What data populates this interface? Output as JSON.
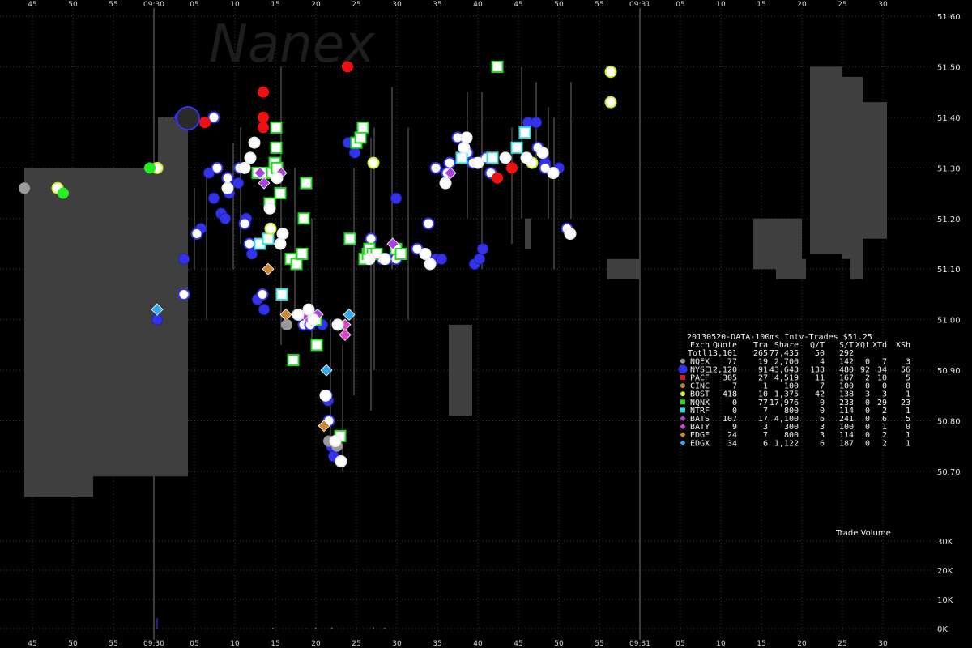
{
  "chart_data": {
    "type": "scatter",
    "watermark": "Nanex",
    "x_axis": {
      "unit": "seconds",
      "ticks": [
        "45",
        "50",
        "55",
        "09:30",
        "05",
        "10",
        "15",
        "20",
        "25",
        "30",
        "35",
        "40",
        "45",
        "50",
        "55",
        "09:31",
        "05",
        "10",
        "15",
        "20",
        "25",
        "30"
      ],
      "xlim": [
        -16,
        96
      ]
    },
    "y_axis_price": {
      "ylim": [
        50.6,
        51.6
      ],
      "ticks": [
        "51.60",
        "51.50",
        "51.40",
        "51.30",
        "51.20",
        "51.10",
        "51.00",
        "50.90",
        "50.80",
        "50.70"
      ]
    },
    "y_axis_volume": {
      "title": "Trade Volume",
      "ticks": [
        "30K",
        "20K",
        "10K",
        "0K"
      ],
      "ylim": [
        0,
        30000
      ]
    },
    "legend_table": {
      "title": "20130520-DATA-100ms Intv-Trades $51.25",
      "columns": [
        "Exch",
        "Quote",
        "Tra",
        "Share",
        "Q/T",
        "S/T",
        "XQt",
        "XTd",
        "XSh"
      ],
      "total_row": [
        "Totl",
        "13,101",
        "265",
        "77,435",
        "50",
        "292",
        "",
        "",
        ""
      ],
      "rows": [
        {
          "exch": "NQEX",
          "quote": "77",
          "tra": "19",
          "share": "2,700",
          "qt": "4",
          "st": "142",
          "xqt": "0",
          "xtd": "7",
          "xsh": "3",
          "color": "#9a9a9a",
          "marker": "circle"
        },
        {
          "exch": "NYSE",
          "quote": "12,120",
          "tra": "91",
          "share": "43,643",
          "qt": "133",
          "st": "480",
          "xqt": "92",
          "xtd": "34",
          "xsh": "56",
          "color": "#3333ee",
          "marker": "circle"
        },
        {
          "exch": "PACF",
          "quote": "305",
          "tra": "27",
          "share": "4,519",
          "qt": "11",
          "st": "167",
          "xqt": "2",
          "xtd": "10",
          "xsh": "5",
          "color": "#ee1111",
          "marker": "square"
        },
        {
          "exch": "CINC",
          "quote": "7",
          "tra": "1",
          "share": "100",
          "qt": "7",
          "st": "100",
          "xqt": "0",
          "xtd": "0",
          "xsh": "0",
          "color": "#b08820",
          "marker": "circle"
        },
        {
          "exch": "BOST",
          "quote": "418",
          "tra": "10",
          "share": "1,375",
          "qt": "42",
          "st": "138",
          "xqt": "3",
          "xtd": "3",
          "xsh": "1",
          "color": "#ccee22",
          "marker": "circle"
        },
        {
          "exch": "NQNX",
          "quote": "0",
          "tra": "77",
          "share": "17,976",
          "qt": "0",
          "st": "233",
          "xqt": "0",
          "xtd": "29",
          "xsh": "23",
          "color": "#22dd22",
          "marker": "square"
        },
        {
          "exch": "NTRF",
          "quote": "0",
          "tra": "7",
          "share": "800",
          "qt": "0",
          "st": "114",
          "xqt": "0",
          "xtd": "2",
          "xsh": "1",
          "color": "#33dddd",
          "marker": "square"
        },
        {
          "exch": "BATS",
          "quote": "107",
          "tra": "17",
          "share": "4,100",
          "qt": "6",
          "st": "241",
          "xqt": "0",
          "xtd": "6",
          "xsh": "5",
          "color": "#aa44dd",
          "marker": "diamond"
        },
        {
          "exch": "BATY",
          "quote": "9",
          "tra": "3",
          "share": "300",
          "qt": "3",
          "st": "100",
          "xqt": "0",
          "xtd": "1",
          "xsh": "0",
          "color": "#dd44cc",
          "marker": "diamond"
        },
        {
          "exch": "EDGE",
          "quote": "24",
          "tra": "7",
          "share": "800",
          "qt": "3",
          "st": "114",
          "xqt": "0",
          "xtd": "2",
          "xsh": "1",
          "color": "#cc8833",
          "marker": "diamond"
        },
        {
          "exch": "EDGX",
          "quote": "34",
          "tra": "6",
          "share": "1,122",
          "qt": "6",
          "st": "187",
          "xqt": "0",
          "xtd": "2",
          "xsh": "1",
          "color": "#33aaee",
          "marker": "diamond"
        }
      ]
    },
    "quote_band_nbbo": [
      {
        "x0": -16,
        "x1": -7.5,
        "low": 50.65,
        "high": 51.3
      },
      {
        "x0": -7.5,
        "x1": -2.5,
        "low": 50.69,
        "high": 51.3
      },
      {
        "x0": -2.5,
        "x1": 0.5,
        "low": 50.69,
        "high": 51.3
      },
      {
        "x0": 0.5,
        "x1": 4.2,
        "low": 50.69,
        "high": 51.4
      },
      {
        "x0": 56,
        "x1": 60,
        "low": 51.08,
        "high": 51.12
      },
      {
        "x0": 74,
        "x1": 80,
        "low": 51.1,
        "high": 51.2
      },
      {
        "x0": 81,
        "x1": 85,
        "low": 51.13,
        "high": 51.5
      },
      {
        "x0": 85,
        "x1": 87.5,
        "low": 51.12,
        "high": 51.48
      },
      {
        "x0": 87.5,
        "x1": 90.5,
        "low": 51.16,
        "high": 51.43
      }
    ],
    "series": [
      {
        "name": "NYSE",
        "marker": "circle",
        "color": "#3333ee",
        "points": [
          [
            3.2,
            51.4
          ],
          [
            3.7,
            51.12
          ],
          [
            5.8,
            51.18
          ],
          [
            6.8,
            51.29
          ],
          [
            7.4,
            51.24
          ],
          [
            8.3,
            51.21
          ],
          [
            8.8,
            51.2
          ],
          [
            9.3,
            51.25
          ],
          [
            10.4,
            51.27
          ],
          [
            11.4,
            51.2
          ],
          [
            12.1,
            51.13
          ],
          [
            12.8,
            51.04
          ],
          [
            13.6,
            51.02
          ],
          [
            19.2,
            50.99
          ],
          [
            20.8,
            50.99
          ],
          [
            21.5,
            50.84
          ],
          [
            21.9,
            50.75
          ],
          [
            22.2,
            50.73
          ],
          [
            24.0,
            51.35
          ],
          [
            24.8,
            51.33
          ],
          [
            29.9,
            51.24
          ],
          [
            34.8,
            51.12
          ],
          [
            35.5,
            51.12
          ],
          [
            39.6,
            51.11
          ],
          [
            40.2,
            51.12
          ],
          [
            40.6,
            51.14
          ],
          [
            46.2,
            51.39
          ],
          [
            47.2,
            51.39
          ],
          [
            48.3,
            51.31
          ],
          [
            49.4,
            51.29
          ],
          [
            50.0,
            51.3
          ],
          [
            0.4,
            51.0
          ]
        ]
      },
      {
        "name": "NYSE-open",
        "marker": "ring",
        "color": "#3333ee",
        "points": [
          [
            3.7,
            51.05
          ],
          [
            5.3,
            51.17
          ],
          [
            7.4,
            51.4
          ],
          [
            7.8,
            51.3
          ],
          [
            9.1,
            51.28
          ],
          [
            10.6,
            51.3
          ],
          [
            11.2,
            51.19
          ],
          [
            11.8,
            51.15
          ],
          [
            13.4,
            51.05
          ],
          [
            18.5,
            50.99
          ],
          [
            19.3,
            50.99
          ],
          [
            21.3,
            50.85
          ],
          [
            21.6,
            50.8
          ],
          [
            26.8,
            51.16
          ],
          [
            28.2,
            51.12
          ],
          [
            28.8,
            51.12
          ],
          [
            29.9,
            51.12
          ],
          [
            32.5,
            51.14
          ],
          [
            33.9,
            51.19
          ],
          [
            34.8,
            51.3
          ],
          [
            36.2,
            51.29
          ],
          [
            36.5,
            51.31
          ],
          [
            37.5,
            51.36
          ],
          [
            38.7,
            51.33
          ],
          [
            39.4,
            51.31
          ],
          [
            41.0,
            51.32
          ],
          [
            41.6,
            51.29
          ],
          [
            47.4,
            51.34
          ],
          [
            48.3,
            51.3
          ],
          [
            51.0,
            51.18
          ]
        ]
      },
      {
        "name": "PACF",
        "marker": "circle",
        "color": "#ee1111",
        "points": [
          [
            13.5,
            51.45
          ],
          [
            13.5,
            51.38
          ],
          [
            13.5,
            51.4
          ],
          [
            42.4,
            51.28
          ],
          [
            44.2,
            51.3
          ],
          [
            23.9,
            51.5
          ],
          [
            6.3,
            51.39
          ]
        ]
      },
      {
        "name": "NQNX",
        "marker": "square",
        "color": "#22dd22",
        "points": [
          [
            12.8,
            51.29
          ],
          [
            13.7,
            51.29
          ],
          [
            14.6,
            51.29
          ],
          [
            14.9,
            51.31
          ],
          [
            15.1,
            51.34
          ],
          [
            15.1,
            51.38
          ],
          [
            14.3,
            51.23
          ],
          [
            15.6,
            51.25
          ],
          [
            15.2,
            51.3
          ],
          [
            16.9,
            51.12
          ],
          [
            17.6,
            51.11
          ],
          [
            18.3,
            51.13
          ],
          [
            18.8,
            51.27
          ],
          [
            18.5,
            51.2
          ],
          [
            20.0,
            51.0
          ],
          [
            20.1,
            50.95
          ],
          [
            23.0,
            50.77
          ],
          [
            24.2,
            51.16
          ],
          [
            25.0,
            51.35
          ],
          [
            25.5,
            51.36
          ],
          [
            26.0,
            51.12
          ],
          [
            26.4,
            51.13
          ],
          [
            26.6,
            51.14
          ],
          [
            27.0,
            51.13
          ],
          [
            27.5,
            51.13
          ],
          [
            29.9,
            51.14
          ],
          [
            30.5,
            51.13
          ],
          [
            25.8,
            51.38
          ],
          [
            17.2,
            50.92
          ],
          [
            42.4,
            51.5
          ]
        ]
      },
      {
        "name": "NTRF",
        "marker": "square",
        "color": "#33dddd",
        "points": [
          [
            13.1,
            51.15
          ],
          [
            14.1,
            51.16
          ],
          [
            15.8,
            51.05
          ],
          [
            38.0,
            51.32
          ],
          [
            41.8,
            51.32
          ],
          [
            44.8,
            51.34
          ],
          [
            45.8,
            51.37
          ]
        ]
      },
      {
        "name": "BATS",
        "marker": "diamond",
        "color": "#aa44dd",
        "points": [
          [
            13.1,
            51.29
          ],
          [
            13.6,
            51.27
          ],
          [
            15.7,
            51.29
          ],
          [
            18.0,
            51.01
          ],
          [
            18.6,
            51.01
          ],
          [
            19.3,
            51.0
          ],
          [
            20.2,
            51.01
          ],
          [
            29.5,
            51.15
          ],
          [
            36.6,
            51.29
          ]
        ]
      },
      {
        "name": "BATY",
        "marker": "diamond",
        "color": "#dd44cc",
        "points": [
          [
            23.6,
            50.97
          ],
          [
            23.6,
            50.99
          ]
        ]
      },
      {
        "name": "EDGE",
        "marker": "diamond",
        "color": "#cc8833",
        "points": [
          [
            14.1,
            51.1
          ],
          [
            21.0,
            50.79
          ],
          [
            16.3,
            51.01
          ]
        ]
      },
      {
        "name": "EDGX",
        "marker": "diamond",
        "color": "#33aaee",
        "points": [
          [
            0.4,
            51.02
          ],
          [
            24.1,
            51.01
          ],
          [
            21.3,
            50.9
          ]
        ]
      },
      {
        "name": "BOST",
        "marker": "ring",
        "color": "#ccee22",
        "points": [
          [
            -11.9,
            51.26
          ],
          [
            27.1,
            51.31
          ],
          [
            56.4,
            51.49
          ],
          [
            56.4,
            51.43
          ],
          [
            46.7,
            51.31
          ],
          [
            0.4,
            51.3
          ],
          [
            14.4,
            51.18
          ]
        ]
      },
      {
        "name": "NQEX",
        "marker": "circle",
        "color": "#9a9a9a",
        "points": [
          [
            16.4,
            50.99
          ],
          [
            21.6,
            50.76
          ],
          [
            22.6,
            50.75
          ],
          [
            -16,
            51.26
          ]
        ]
      },
      {
        "name": "Green-quote",
        "marker": "circle",
        "color": "#22ee22",
        "points": [
          [
            -11.2,
            51.25
          ],
          [
            -0.5,
            51.3
          ]
        ]
      },
      {
        "name": "Other-white",
        "marker": "ring",
        "color": "#eeeeee",
        "points": [
          [
            9.1,
            51.26
          ],
          [
            11.2,
            51.3
          ],
          [
            11.9,
            51.32
          ],
          [
            12.4,
            51.35
          ],
          [
            14.3,
            51.22
          ],
          [
            15.2,
            51.28
          ],
          [
            15.6,
            51.15
          ],
          [
            15.9,
            51.17
          ],
          [
            17.8,
            51.01
          ],
          [
            19.1,
            51.02
          ],
          [
            19.7,
            51.0
          ],
          [
            21.2,
            50.85
          ],
          [
            22.4,
            50.76
          ],
          [
            23.1,
            50.72
          ],
          [
            22.7,
            50.99
          ],
          [
            26.6,
            51.12
          ],
          [
            28.5,
            51.12
          ],
          [
            33.5,
            51.13
          ],
          [
            34.1,
            51.11
          ],
          [
            36.0,
            51.27
          ],
          [
            38.3,
            51.34
          ],
          [
            38.6,
            51.36
          ],
          [
            40.0,
            51.31
          ],
          [
            43.4,
            51.32
          ],
          [
            46.0,
            51.32
          ],
          [
            48.0,
            51.33
          ],
          [
            49.3,
            51.29
          ],
          [
            51.4,
            51.17
          ]
        ]
      }
    ],
    "trade_volume_bars": [
      {
        "x": 0.4,
        "value": 3600,
        "color": "#3333ee"
      },
      {
        "x": 14.7,
        "value": 300,
        "color": "#22dd22"
      },
      {
        "x": 18.8,
        "value": 200,
        "color": "#ee1111"
      },
      {
        "x": 20.0,
        "value": 300,
        "color": "#22dd22"
      },
      {
        "x": 22.0,
        "value": 400,
        "color": "#22dd22"
      },
      {
        "x": 27.1,
        "value": 500,
        "color": "#22dd22"
      },
      {
        "x": 28.5,
        "value": 300,
        "color": "#22dd22"
      },
      {
        "x": 40.2,
        "value": 200,
        "color": "#3333ee"
      }
    ]
  }
}
